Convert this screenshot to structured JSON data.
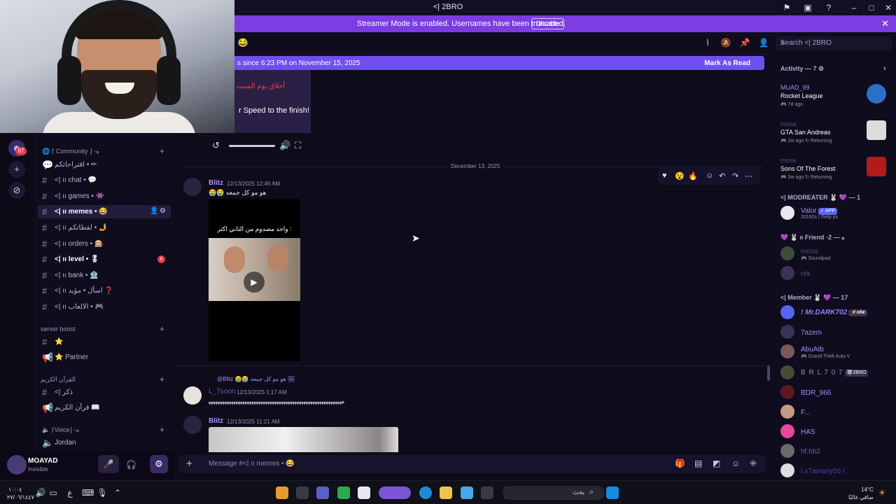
{
  "window": {
    "title": "<| 2BRO"
  },
  "banner": {
    "text": "Streamer Mode is enabled. Usernames have been truncated.",
    "button": "Disable"
  },
  "search": {
    "placeholder": "Search <| 2BRO"
  },
  "newbar": {
    "text": "s since 6:23 PM on November 15, 2025",
    "action": "Mark As Read"
  },
  "video_preview": {
    "arabic": "أخلاق يوم السبت",
    "text": "r Speed to the finish!"
  },
  "rail": {
    "badge": "67"
  },
  "sidebar": {
    "community_category": "⌈ Community ⌋ ◦ﻩ",
    "items": [
      {
        "label": "اقتراحاتكم • ✏"
      },
      {
        "label": "<| ıı chat • 💬"
      },
      {
        "label": "<| ıı games • 👾"
      },
      {
        "label": "<| ıı memes • 😂"
      },
      {
        "label": "<| ıı لقطاتكم • 🤳"
      },
      {
        "label": "<| ıı orders • 🎰"
      },
      {
        "label": "<| ıı level • 🎖",
        "badge": "6"
      },
      {
        "label": "<| ıı bank • 🏦"
      },
      {
        "label": "<| ıı اسأل • مؤيد ❓"
      },
      {
        "label": "<| ıı الالعاب • 🎮"
      }
    ],
    "boost_category": "server boost",
    "boost_items": [
      {
        "label": "⭐"
      },
      {
        "label": "⭐ Partner"
      }
    ],
    "quran_category": "القرآن الكريم",
    "quran_items": [
      {
        "label": "<| ذكر"
      },
      {
        "label": "قرآن الكريم 📖"
      }
    ],
    "voice_category": "⌈Voice⌋ ◦ﻩ",
    "voice_items": [
      {
        "label": "Jordan"
      }
    ]
  },
  "user": {
    "name": "MOAYAD",
    "status": "Invisible"
  },
  "chat": {
    "date": "December 13, 2025",
    "messages": [
      {
        "author": "Blitz",
        "time": "12/13/2025 12:46 AM",
        "text": "😭😭 هو مو كل جمعه",
        "video_caption": "واحد مصدوم من الثاني اكثر :"
      },
      {
        "reply": "@Blitz 😭😭 هو مو كل جمعه 🖼",
        "author": "L_7soon",
        "time": "12/13/2025 1:17 AM",
        "text": "ﻫﻬﻬﻬﻬﻬﻬﻬﻬﻬﻬﻬﻬﻬﻬﻬﻬﻬﻬﻬﻬﻬﻬﻬﻬﻬﻬﻬﻬﻬﻬﻬﻬﻬﻬﻬﻬﻬﻬﻬﻬﻬﻬﻬﻬﻬﻬﻬﻬﻬﻬﻬﻬﻬﻬﻬﻬﻬﻬﻬ"
      },
      {
        "author": "Blitz",
        "time": "12/13/2025 11:21 AM"
      }
    ]
  },
  "composer": {
    "placeholder": "Message #<| ıı memes • 😂"
  },
  "members": {
    "activity_header": "Activity — 7 ⚙",
    "activities": [
      {
        "name": "MUAD_99",
        "game": "Rocket League",
        "sub": "🎮 7d ago"
      },
      {
        "name": "mosa",
        "game": "GTA San Andreas",
        "sub": "🎮 2w ago  ↻ Returning"
      },
      {
        "name": "mosa",
        "game": "Sons Of The Forest",
        "sub": "🎮 3w ago  ↻ Returning"
      }
    ],
    "moderator_header": "<| MODREATER 🐰 💜 — 1",
    "moderators": [
      {
        "name": "Valor",
        "tag": "✓ APP",
        "sub": "20192s | /help ps"
      }
    ],
    "friend_header": "💜 🐰 ıı Friend ◦ﻩ — 2",
    "friends": [
      {
        "name": "mosa",
        "sub": "🎮 Soundpad"
      },
      {
        "name": "rek"
      }
    ],
    "member_header": "<| Member 🐰 💜 — 17",
    "members": [
      {
        "name": "! Mr.DARK702",
        "tag": "⚡olw"
      },
      {
        "name": "7azem"
      },
      {
        "name": "AbuAtb",
        "sub": "🎮 Grand Theft Auto V"
      },
      {
        "name": "B R L 7 0 7",
        "tag": "🐺2BRO"
      },
      {
        "name": "BDR_966"
      },
      {
        "name": "F..."
      },
      {
        "name": "HAS"
      },
      {
        "name": "hf.hb2"
      },
      {
        "name": "I.x7amany55 I"
      }
    ]
  },
  "taskbar": {
    "search": "بحث",
    "temp": "14°C",
    "weather": "صافي غالبًا",
    "time": "١٠:٠٤",
    "date": "٢٧/٠٦/١٤٤٧"
  }
}
